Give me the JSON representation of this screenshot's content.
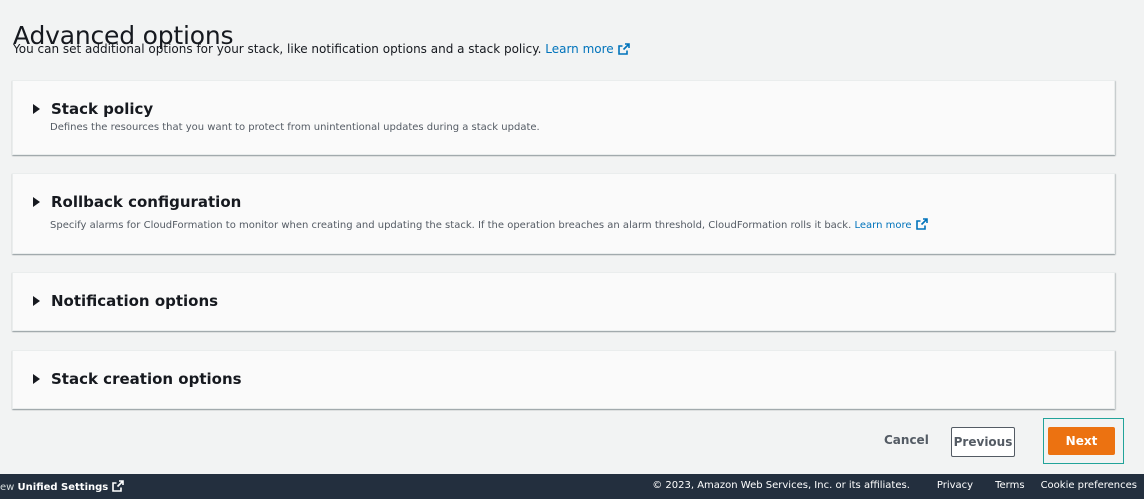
{
  "header": {
    "title": "Advanced options",
    "description": "You can set additional options for your stack, like notification options and a stack policy.",
    "learn_more": "Learn more"
  },
  "panels": [
    {
      "title": "Stack policy",
      "description": "Defines the resources that you want to protect from unintentional updates during a stack update.",
      "expanded": false
    },
    {
      "title": "Rollback configuration",
      "description": "Specify alarms for CloudFormation to monitor when creating and updating the stack. If the operation breaches an alarm threshold, CloudFormation rolls it back.",
      "learn_more": "Learn more",
      "expanded": false
    },
    {
      "title": "Notification options",
      "expanded": false
    },
    {
      "title": "Stack creation options",
      "expanded": false
    }
  ],
  "actions": {
    "cancel": "Cancel",
    "previous": "Previous",
    "next": "Next"
  },
  "footer": {
    "left_prefix": "ew",
    "unified_settings": "Unified Settings",
    "copyright": "© 2023, Amazon Web Services, Inc. or its affiliates.",
    "privacy": "Privacy",
    "terms": "Terms",
    "cookie_preferences": "Cookie preferences"
  },
  "colors": {
    "link": "#0073bb",
    "primary_button": "#ec7211",
    "footer_bg": "#232f3e",
    "page_bg": "#f2f3f3"
  }
}
